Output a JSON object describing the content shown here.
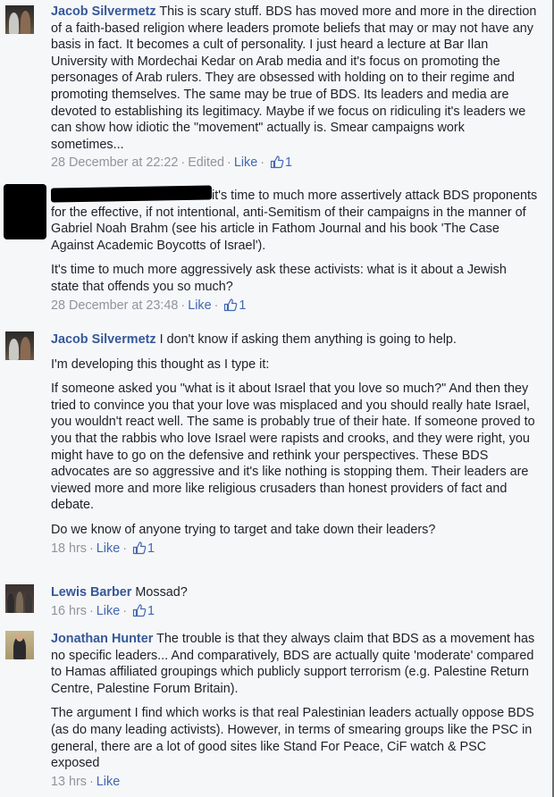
{
  "comments": [
    {
      "author": "Jacob Silvermetz",
      "paragraphs": [
        "This is scary stuff. BDS has moved more and more in the direction of a faith-based religion where leaders promote beliefs that may or may not have any basis in fact. It becomes a cult of personality. I just heard a lecture at Bar Ilan University with Mordechai Kedar on Arab media and it's focus on promoting the personages of Arab rulers. They are obsessed with holding on to their regime and promoting themselves. The same may be true of BDS. Its leaders and media are devoted to establishing its legitimacy. Maybe if we focus on ridiculing it's leaders we can show how idiotic the \"movement\" actually is. Smear campaigns work sometimes..."
      ],
      "timestamp": "28 December at 22:22",
      "edited": "Edited",
      "like_label": "Like",
      "like_count": "1"
    },
    {
      "author": "",
      "paragraphs": [
        "it's time to much more assertively attack BDS proponents for the effective, if not intentional, anti-Semitism of their campaigns in the manner of Gabriel Noah Brahm (see his article in Fathom Journal and his book 'The Case Against Academic Boycotts of Israel').",
        "It's time to much more aggressively ask these activists: what is it about a Jewish state that offends you so much?"
      ],
      "timestamp": "28 December at 23:48",
      "like_label": "Like",
      "like_count": "1"
    },
    {
      "author": "Jacob Silvermetz",
      "paragraphs": [
        "I don't know if asking them anything is going to help.",
        "I'm developing this thought as I type it:",
        "If someone asked you \"what is it about Israel that you love so much?\" And then they tried to convince you that your love was misplaced and you should really hate Israel, you wouldn't react well. The same is probably true of their hate. If someone proved to you that the rabbis who love Israel were rapists and crooks, and they were right, you might have to go on the defensive and rethink your perspectives. These BDS advocates are so aggressive and it's like nothing is stopping them. Their leaders are viewed more and more like religious crusaders than honest providers of fact and debate.",
        "Do we know of anyone trying to target and take down their leaders?"
      ],
      "timestamp": "18 hrs",
      "like_label": "Like",
      "like_count": "1"
    },
    {
      "author": "Lewis Barber",
      "paragraphs": [
        "Mossad?"
      ],
      "timestamp": "16 hrs",
      "like_label": "Like",
      "like_count": "1"
    },
    {
      "author": "Jonathan Hunter",
      "paragraphs": [
        "The trouble is that they always claim that BDS as a movement has no specific leaders... And comparatively, BDS are actually quite 'moderate' compared to Hamas affiliated groupings which publicly support terrorism (e.g. Palestine Return Centre, Palestine Forum Britain).",
        "The argument I find which works is that real Palestinian leaders actually oppose BDS (as do many leading activists). However, in terms of smearing groups like the PSC in general, there are a lot of good sites like Stand For Peace, CiF watch & PSC exposed"
      ],
      "timestamp": "13 hrs",
      "like_label": "Like"
    }
  ],
  "colors": {
    "author_link": "#365899",
    "action_link": "#4267b2",
    "meta_text": "#90949c",
    "body_text": "#1d2129",
    "background": "#f6f7f9"
  },
  "icons": {
    "like": "thumbs-up-icon"
  }
}
